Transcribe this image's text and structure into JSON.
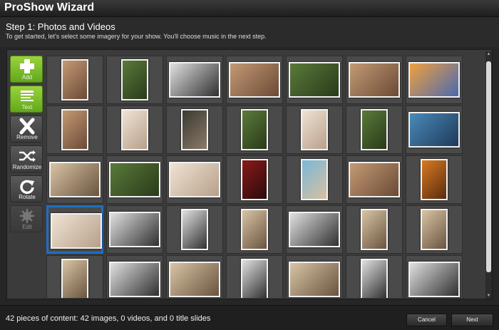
{
  "window": {
    "title": "ProShow Wizard"
  },
  "header": {
    "step_title": "Step 1: Photos and Videos",
    "step_description": "To get started, let's select some imagery for your show. You'll choose music in the next step."
  },
  "toolbar": {
    "items": [
      {
        "label": "Add",
        "icon": "plus-icon",
        "enabled": true
      },
      {
        "label": "Text",
        "icon": "text-icon",
        "enabled": true
      },
      {
        "label": "Remove",
        "icon": "remove-x-icon",
        "enabled": true
      },
      {
        "label": "Randomize",
        "icon": "shuffle-icon",
        "enabled": true
      },
      {
        "label": "Rotate",
        "icon": "rotate-icon",
        "enabled": true
      },
      {
        "label": "Edit",
        "icon": "gear-icon",
        "enabled": false
      }
    ]
  },
  "grid": {
    "columns": 7,
    "selected_index": 21,
    "thumbnails": [
      {
        "orientation": "portrait",
        "tone": "warm"
      },
      {
        "orientation": "portrait",
        "tone": "green"
      },
      {
        "orientation": "landscape",
        "tone": "bw"
      },
      {
        "orientation": "landscape",
        "tone": "warm"
      },
      {
        "orientation": "landscape",
        "tone": "green"
      },
      {
        "orientation": "landscape",
        "tone": "warm"
      },
      {
        "orientation": "landscape",
        "tone": "sunset"
      },
      {
        "orientation": "portrait",
        "tone": "warm"
      },
      {
        "orientation": "portrait",
        "tone": "light"
      },
      {
        "orientation": "portrait",
        "tone": "dark"
      },
      {
        "orientation": "portrait",
        "tone": "green"
      },
      {
        "orientation": "portrait",
        "tone": "light"
      },
      {
        "orientation": "portrait",
        "tone": "green"
      },
      {
        "orientation": "landscape",
        "tone": "blue"
      },
      {
        "orientation": "landscape",
        "tone": "sepia"
      },
      {
        "orientation": "landscape",
        "tone": "green"
      },
      {
        "orientation": "landscape",
        "tone": "light"
      },
      {
        "orientation": "portrait",
        "tone": "red"
      },
      {
        "orientation": "portrait",
        "tone": "beach"
      },
      {
        "orientation": "landscape",
        "tone": "warm"
      },
      {
        "orientation": "portrait",
        "tone": "orange"
      },
      {
        "orientation": "landscape",
        "tone": "light"
      },
      {
        "orientation": "landscape",
        "tone": "bw"
      },
      {
        "orientation": "portrait",
        "tone": "bw"
      },
      {
        "orientation": "portrait",
        "tone": "sepia"
      },
      {
        "orientation": "landscape",
        "tone": "bw"
      },
      {
        "orientation": "portrait",
        "tone": "sepia"
      },
      {
        "orientation": "portrait",
        "tone": "sepia"
      },
      {
        "orientation": "portrait",
        "tone": "sepia"
      },
      {
        "orientation": "landscape",
        "tone": "bw"
      },
      {
        "orientation": "landscape",
        "tone": "sepia"
      },
      {
        "orientation": "portrait",
        "tone": "bw"
      },
      {
        "orientation": "landscape",
        "tone": "sepia"
      },
      {
        "orientation": "portrait",
        "tone": "bw"
      },
      {
        "orientation": "landscape",
        "tone": "bw"
      }
    ]
  },
  "status": {
    "text": "42 pieces of content: 42 images, 0 videos, and 0 title slides"
  },
  "buttons": {
    "cancel": "Cancel",
    "next": "Next"
  },
  "colors": {
    "accent_green": "#7cc22a",
    "selection_blue": "#1f6fc2",
    "tones": {
      "warm": [
        "#c49a74",
        "#6b4a36"
      ],
      "green": [
        "#5a7a3a",
        "#2a3a1a"
      ],
      "bw": [
        "#e0e0e0",
        "#303030"
      ],
      "light": [
        "#efe3d4",
        "#b8a08a"
      ],
      "dark": [
        "#3a3a30",
        "#8a7a6a"
      ],
      "sunset": [
        "#f0a040",
        "#4a6ab0"
      ],
      "blue": [
        "#4a8ab8",
        "#1e3a5a"
      ],
      "sepia": [
        "#d8c4a4",
        "#6a5440"
      ],
      "red": [
        "#8a1a1a",
        "#2a0a0a"
      ],
      "beach": [
        "#7ab8d8",
        "#d8c0a0"
      ],
      "orange": [
        "#d87a20",
        "#5a2a10"
      ]
    }
  }
}
